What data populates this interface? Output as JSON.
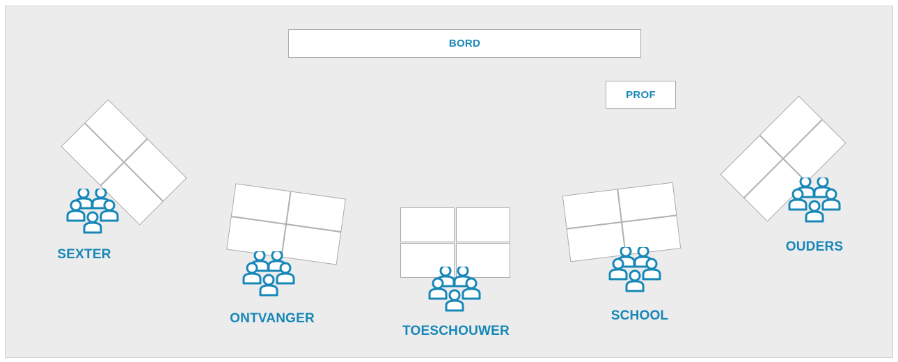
{
  "board": {
    "label": "BORD"
  },
  "teacher": {
    "label": "PROF"
  },
  "groups": {
    "sexter": {
      "label": "SEXTER"
    },
    "ontvanger": {
      "label": "ONTVANGER"
    },
    "toeschouwer": {
      "label": "TOESCHOUWER"
    },
    "school": {
      "label": "SCHOOL"
    },
    "ouders": {
      "label": "OUDERS"
    }
  },
  "colors": {
    "accent": "#1787b8",
    "floor": "#ececec",
    "desk": "#ffffff",
    "desk_border": "#a9a9a9"
  },
  "icons": {
    "group": "group-of-people-icon"
  }
}
